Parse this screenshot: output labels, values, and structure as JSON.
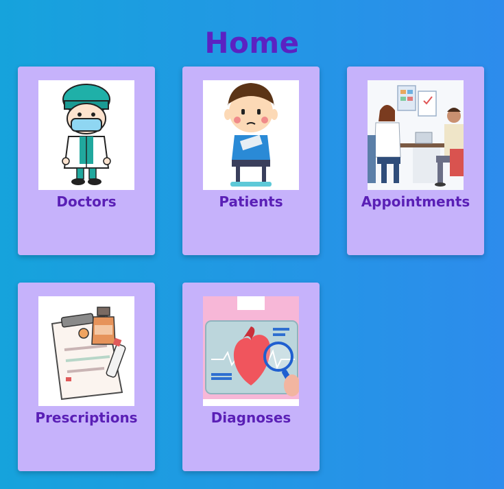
{
  "page": {
    "title": "Home"
  },
  "cards": [
    {
      "label": "Doctors",
      "icon": "doctor-illustration"
    },
    {
      "label": "Patients",
      "icon": "patient-illustration"
    },
    {
      "label": "Appointments",
      "icon": "appointment-illustration"
    },
    {
      "label": "Prescriptions",
      "icon": "prescription-illustration"
    },
    {
      "label": "Diagnoses",
      "icon": "diagnosis-illustration"
    }
  ],
  "colors": {
    "background_start": "#16a3dc",
    "background_end": "#2d8cec",
    "card": "#c6b2fb",
    "title": "#5b22c2",
    "label": "#5a1fb6"
  }
}
